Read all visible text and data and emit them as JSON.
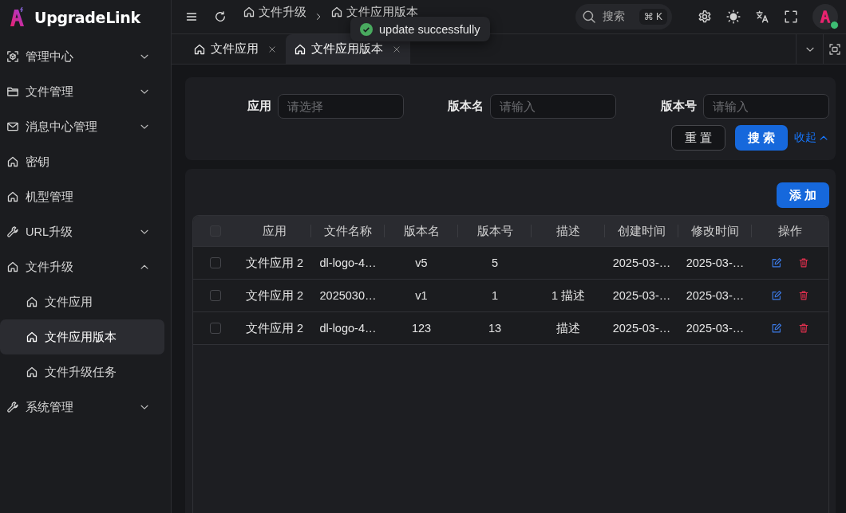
{
  "brand": {
    "name": "UpgradeLink"
  },
  "sidebar": {
    "items": [
      {
        "kind": "group",
        "label": "管理中心",
        "expanded": false,
        "selected": false
      },
      {
        "kind": "group",
        "label": "文件管理",
        "expanded": false,
        "selected": false
      },
      {
        "kind": "group",
        "label": "消息中心管理",
        "expanded": false,
        "selected": false
      },
      {
        "kind": "link",
        "label": "密钥",
        "selected": false
      },
      {
        "kind": "link",
        "label": "机型管理",
        "selected": false
      },
      {
        "kind": "group",
        "label": "URL升级",
        "expanded": false,
        "selected": false
      },
      {
        "kind": "group",
        "label": "文件升级",
        "expanded": true,
        "selected": false,
        "children": [
          {
            "kind": "link",
            "label": "文件应用",
            "selected": false
          },
          {
            "kind": "link",
            "label": "文件应用版本",
            "selected": true
          },
          {
            "kind": "link",
            "label": "文件升级任务",
            "selected": false
          }
        ]
      },
      {
        "kind": "group",
        "label": "系统管理",
        "expanded": false,
        "selected": false
      }
    ]
  },
  "header": {
    "breadcrumb": [
      {
        "label": "文件升级"
      },
      {
        "label": "文件应用版本"
      }
    ],
    "search": {
      "label": "搜索",
      "shortcut": "⌘ K"
    },
    "user": {
      "online": true
    }
  },
  "toast": {
    "message": "update successfully"
  },
  "tabs": [
    {
      "label": "文件应用",
      "selected": false
    },
    {
      "label": "文件应用版本",
      "selected": true
    }
  ],
  "filter": {
    "fields": [
      {
        "label": "应用",
        "placeholder": "请选择"
      },
      {
        "label": "版本名",
        "placeholder": "请输入"
      },
      {
        "label": "版本号",
        "placeholder": "请输入"
      }
    ],
    "reset": "重 置",
    "submit": "搜 索",
    "collapse": "收起"
  },
  "table": {
    "add_button": "添 加",
    "header_checked": false,
    "columns": [
      "应用",
      "文件名称",
      "版本名",
      "版本号",
      "描述",
      "创建时间",
      "修改时间",
      "操作"
    ],
    "rows": [
      {
        "checked": false,
        "app": "文件应用 2",
        "file_name": "dl-logo-4…",
        "version_name": "v5",
        "version_number": "5",
        "created_at": "2025-03-…",
        "updated_at": "2025-03-…"
      },
      {
        "checked": false,
        "app": "文件应用 2",
        "file_name": "2025030…",
        "version_name": "v1",
        "version_number": "1",
        "description": "1 描述",
        "created_at": "2025-03-…",
        "updated_at": "2025-03-…"
      },
      {
        "checked": false,
        "app": "文件应用 2",
        "file_name": "dl-logo-4…",
        "version_name": "123",
        "version_number": "13",
        "description": "描述",
        "created_at": "2025-03-…",
        "updated_at": "2025-03-…"
      }
    ]
  }
}
